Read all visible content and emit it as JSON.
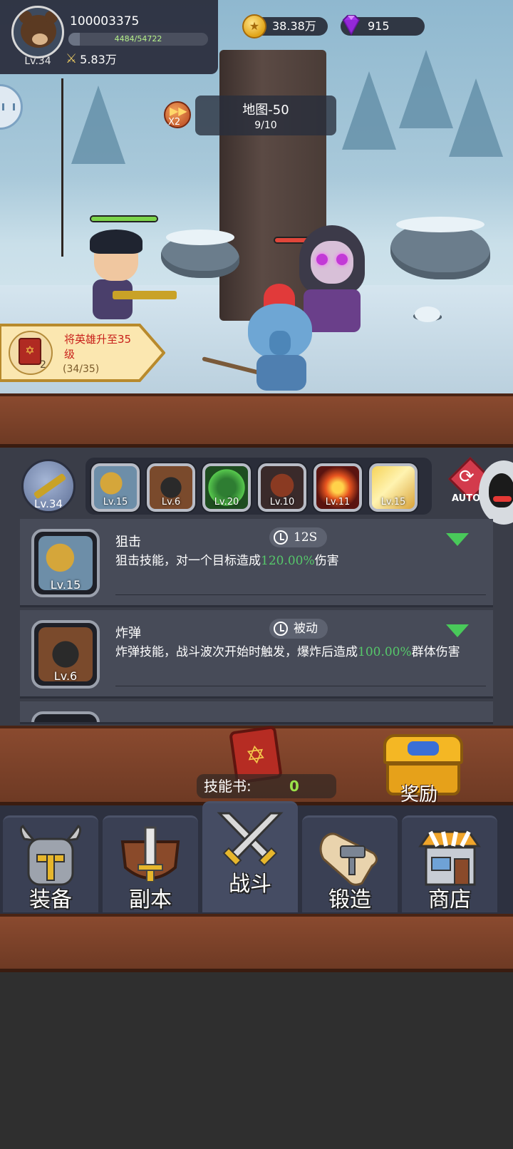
{
  "player": {
    "id": "100003375",
    "level_label": "Lv.34",
    "exp_text": "4484/54722",
    "exp_fraction": 0.082,
    "power": "5.83万"
  },
  "currencies": {
    "gold": "38.38万",
    "gems": "915"
  },
  "battle": {
    "speed_label": "X2",
    "map_title": "地图-50",
    "wave": "9/10",
    "hero_hp_fraction": 1.0,
    "enemy_hp_fraction": 0.55
  },
  "quest": {
    "text": "将英雄升至35级",
    "book_count": "2",
    "progress": "(34/35)"
  },
  "weapon": {
    "level_label": "Lv.34"
  },
  "skill_strip": [
    {
      "icon": "snipe-skill-icon",
      "level": "Lv.15"
    },
    {
      "icon": "bomb-skill-icon",
      "level": "Lv.6"
    },
    {
      "icon": "heal-skill-icon",
      "level": "Lv.20"
    },
    {
      "icon": "beast-skill-icon",
      "level": "Lv.10"
    },
    {
      "icon": "fireball-skill-icon",
      "level": "Lv.11"
    },
    {
      "icon": "lightning-skill-icon",
      "level": "Lv.15"
    }
  ],
  "auto_label": "AUTO",
  "skill_cards": [
    {
      "name": "狙击",
      "cooldown": "12S",
      "desc_before": "狙击技能，对一个目标造成",
      "desc_pct": "120.00%",
      "desc_after": "伤害",
      "level": "Lv.15"
    },
    {
      "name": "炸弹",
      "cooldown": "被动",
      "desc_before": "炸弹技能，战斗波次开始时触发，爆炸后造成",
      "desc_pct": "100.00%",
      "desc_after": "群体伤害",
      "level": "Lv.6"
    }
  ],
  "skill_book": {
    "label": "技能书:",
    "count": "0"
  },
  "reward_label": "奖励",
  "nav": [
    {
      "label": "装备",
      "icon": "helmet-icon"
    },
    {
      "label": "副本",
      "icon": "sword-shield-icon"
    },
    {
      "label": "战斗",
      "icon": "crossed-swords-icon"
    },
    {
      "label": "锻造",
      "icon": "forge-scroll-icon"
    },
    {
      "label": "商店",
      "icon": "shop-icon"
    }
  ],
  "colors": {
    "hp_green": "#7bd34a",
    "hp_red": "#e0463a",
    "highlight_green": "#56c86a",
    "plank": "#7a4129"
  }
}
